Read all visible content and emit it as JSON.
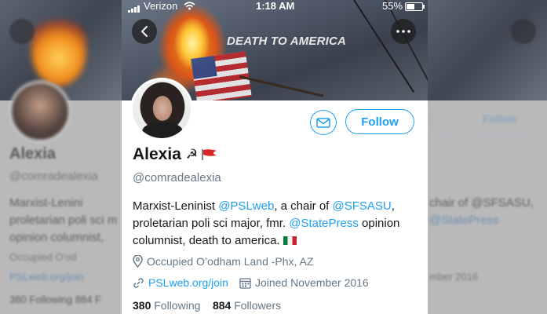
{
  "status_bar": {
    "carrier": "Verizon",
    "time": "1:18 AM",
    "battery": "55%"
  },
  "banner": {
    "text": "DEATH TO AMERICA"
  },
  "profile": {
    "name": "Alexia",
    "name_emoji": "☭",
    "handle": "@comradealexia",
    "follow_label": "Follow",
    "bio": {
      "p1": "Marxist-Leninist ",
      "link1": "@PSLweb",
      "p2": ", a chair of ",
      "link2": "@SFSASU",
      "p3": ", proletarian poli sci major, fmr. ",
      "link3": "@StatePress",
      "p4": " opinion columnist, death to america."
    },
    "location": "Occupied O’odham Land -Phx, AZ",
    "website": "PSLweb.org/join",
    "joined": "Joined November 2016",
    "following_count": "380",
    "following_label": "Following",
    "followers_count": "884",
    "followers_label": "Followers"
  },
  "colors": {
    "accent": "#1da1f2",
    "text_primary": "#14171a",
    "text_secondary": "#657786"
  },
  "icons": [
    "back-arrow-icon",
    "more-icon",
    "mail-icon",
    "location-pin-icon",
    "link-icon",
    "calendar-icon",
    "wifi-icon",
    "battery-icon"
  ],
  "background_blur": {
    "name": "Alexia",
    "handle": "@comradealexia",
    "bio_left_1": "Marxist-Lenini",
    "bio_left_2": "proletarian poli sci m",
    "bio_left_3": "opinion columnist,",
    "location_left": "Occupied O'od",
    "website_left": "PSLweb.org/join",
    "counts_left": "380 Following   884 F",
    "bio_right_1": "chair of @SFSASU,",
    "bio_right_2": "@StatePress",
    "joined_right": "mber 2016",
    "follow_right": "Follow"
  }
}
